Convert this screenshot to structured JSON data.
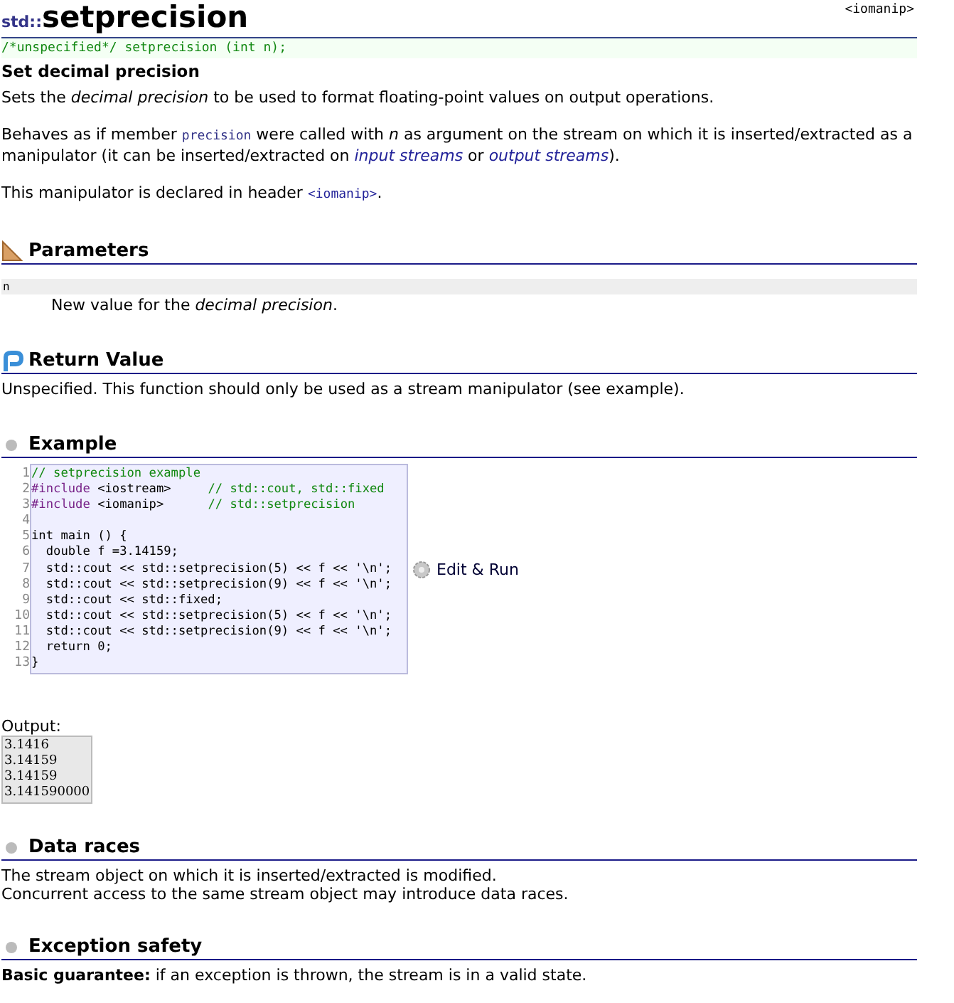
{
  "header": {
    "namespace": "std::",
    "title": "setprecision",
    "header_file": "<iomanip>"
  },
  "prototype": "/*unspecified*/ setprecision (int n);",
  "summary": "Set decimal precision",
  "description": [
    [
      {
        "kind": "plain",
        "text": "Sets the "
      },
      {
        "kind": "italic",
        "text": "decimal precision"
      },
      {
        "kind": "plain",
        "text": " to be used to format floating-point values on output operations."
      }
    ],
    [
      {
        "kind": "plain",
        "text": "Behaves as if member "
      },
      {
        "kind": "code",
        "text": "precision"
      },
      {
        "kind": "plain",
        "text": " were called with "
      },
      {
        "kind": "italic",
        "text": "n"
      },
      {
        "kind": "plain",
        "text": " as argument on the stream on which it is inserted/extracted as a manipulator (it can be inserted/extracted on "
      },
      {
        "kind": "link",
        "text": "input streams"
      },
      {
        "kind": "plain",
        "text": " or "
      },
      {
        "kind": "link",
        "text": "output streams"
      },
      {
        "kind": "plain",
        "text": ")."
      }
    ],
    [
      {
        "kind": "plain",
        "text": "This manipulator is declared in header "
      },
      {
        "kind": "codelink",
        "text": "<iomanip>"
      },
      {
        "kind": "plain",
        "text": "."
      }
    ]
  ],
  "sections": [
    {
      "kind": "parameters",
      "title": "Parameters",
      "params": [
        {
          "name": "n",
          "text": "New value for the *decimal precision*."
        }
      ]
    },
    {
      "kind": "return",
      "title": "Return Value",
      "paragraphs": [
        "Unspecified. This function should only be used as a stream manipulator (see example)."
      ]
    },
    {
      "kind": "example",
      "title": "Example",
      "run_label": "Edit & Run",
      "output_label": "Output:",
      "output": [
        "3.1416",
        "3.14159",
        "3.14159",
        "3.141590000"
      ],
      "code": [
        {
          "number": "1",
          "parts": [
            {
              "kind": "comment",
              "text": "// setprecision example"
            }
          ]
        },
        {
          "number": "2",
          "parts": [
            {
              "kind": "pre",
              "text": "#include "
            },
            {
              "kind": "plain",
              "text": "<iostream>     "
            },
            {
              "kind": "comment",
              "text": "// std::cout, std::fixed"
            }
          ]
        },
        {
          "number": "3",
          "parts": [
            {
              "kind": "pre",
              "text": "#include "
            },
            {
              "kind": "plain",
              "text": "<iomanip>      "
            },
            {
              "kind": "comment",
              "text": "// std::setprecision"
            }
          ]
        },
        {
          "number": "4"
        },
        {
          "number": "5",
          "parts": [
            {
              "kind": "plain",
              "text": "int main () {"
            }
          ]
        },
        {
          "number": "6",
          "parts": [
            {
              "kind": "plain",
              "text": "  double f =3.14159;"
            }
          ]
        },
        {
          "number": "7",
          "parts": [
            {
              "kind": "plain",
              "text": "  std::cout << std::setprecision(5) << f << '\\n';"
            }
          ]
        },
        {
          "number": "8",
          "parts": [
            {
              "kind": "plain",
              "text": "  std::cout << std::setprecision(9) << f << '\\n';"
            }
          ]
        },
        {
          "number": "9",
          "parts": [
            {
              "kind": "plain",
              "text": "  std::cout << std::fixed;"
            }
          ]
        },
        {
          "number": "10",
          "parts": [
            {
              "kind": "plain",
              "text": "  std::cout << std::setprecision(5) << f << '\\n';"
            }
          ]
        },
        {
          "number": "11",
          "parts": [
            {
              "kind": "plain",
              "text": "  std::cout << std::setprecision(9) << f << '\\n';"
            }
          ]
        },
        {
          "number": "12",
          "parts": [
            {
              "kind": "plain",
              "text": "  return 0;"
            }
          ]
        },
        {
          "number": "13",
          "parts": [
            {
              "kind": "plain",
              "text": "}"
            }
          ]
        }
      ]
    },
    {
      "kind": "bullet",
      "title": "Data races",
      "paragraphs": [
        "The stream object on which it is inserted/extracted is modified.",
        "Concurrent access to the same stream object may introduce data races."
      ]
    },
    {
      "kind": "bullet",
      "title": "Exception safety",
      "paragraphs": [
        "**Basic guarantee:** if an exception is thrown, the stream is in a valid state."
      ]
    }
  ]
}
